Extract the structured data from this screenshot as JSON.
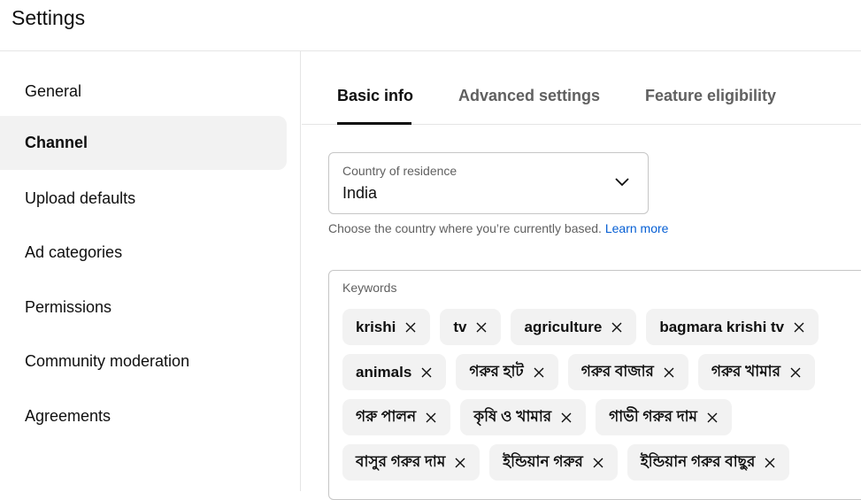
{
  "header": {
    "title": "Settings"
  },
  "sidebar": {
    "items": [
      {
        "label": "General",
        "active": false
      },
      {
        "label": "Channel",
        "active": true
      },
      {
        "label": "Upload defaults",
        "active": false
      },
      {
        "label": "Ad categories",
        "active": false
      },
      {
        "label": "Permissions",
        "active": false
      },
      {
        "label": "Community moderation",
        "active": false
      },
      {
        "label": "Agreements",
        "active": false
      }
    ]
  },
  "tabs": [
    {
      "label": "Basic info",
      "active": true
    },
    {
      "label": "Advanced settings",
      "active": false
    },
    {
      "label": "Feature eligibility",
      "active": false
    }
  ],
  "country": {
    "label": "Country of residence",
    "value": "India",
    "helper": "Choose the country where you’re currently based.",
    "link": "Learn more"
  },
  "keywords": {
    "label": "Keywords",
    "chips": [
      "krishi",
      "tv",
      "agriculture",
      "bagmara krishi tv",
      "animals",
      "গরুর হাট",
      "গরুর বাজার",
      "গরুর খামার",
      "গরু পালন",
      "কৃষি ও খামার",
      "গাভী গরুর দাম",
      "বাসুর গরুর দাম",
      "ইন্ডিয়ান গরুর",
      "ইন্ডিয়ান গরুর বাছুর"
    ]
  },
  "colors": {
    "accent_link": "#065fd4",
    "active_bg": "#f2f2f2",
    "chip_bg": "#f2f2f2"
  }
}
